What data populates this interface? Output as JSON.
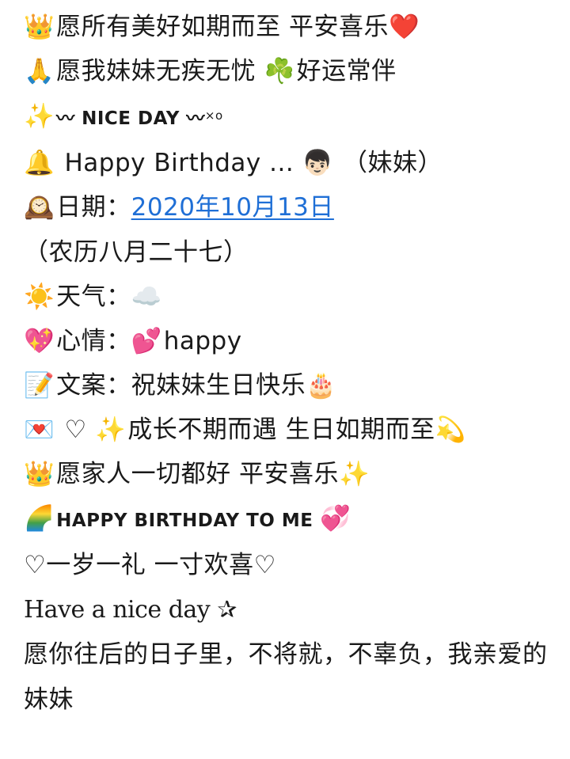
{
  "lines": [
    {
      "emoji": "👑",
      "text": "愿所有美好如期而至 平安喜乐",
      "emoji_end": "❤️"
    },
    {
      "emoji": "🙏",
      "text": "愿我妹妹无疾无忧 ",
      "emoji_mid": "☘️",
      "text2": "好运常伴"
    },
    {
      "emoji": "✨",
      "deco1": "〰",
      "text": " NICE DAY ",
      "deco2": "〰",
      "tail": "×o"
    },
    {
      "emoji": "🔔",
      "text": " Happy Birthday ... ",
      "emoji_mid": "👦🏻",
      "text2": " （妹妹）"
    },
    {
      "emoji": "🕰️",
      "text": "日期：",
      "date": "2020年10月13日",
      "text2": "（农历八月二十七）"
    },
    {
      "emoji": "☀️",
      "text": "天气：",
      "emoji_end": "☁️"
    },
    {
      "emoji": "💖",
      "text": "心情：",
      "emoji_mid": "💕",
      "text2": "happy"
    },
    {
      "emoji": "📝",
      "text": "文案：祝妹妹生日快乐",
      "emoji_end": "🎂"
    },
    {
      "emoji": "💌",
      "sym": " ♡ ",
      "emoji_mid": "✨",
      "text": "成长不期而遇  生日如期而至",
      "emoji_end": "💫"
    },
    {
      "emoji": "👑",
      "text": "愿家人一切都好  平安喜乐",
      "emoji_end": "✨"
    },
    {
      "emoji": "🌈",
      "text": "HAPPY BIRTHDAY TO ME ",
      "emoji_end": "💞"
    },
    {
      "text": "♡一岁一礼 一寸欢喜♡"
    },
    {
      "text": "Have a nice day ",
      "sym_end": "✰"
    },
    {
      "text": "愿你往后的日子里，不将就，不辜负，我亲爱的妹妹"
    }
  ]
}
